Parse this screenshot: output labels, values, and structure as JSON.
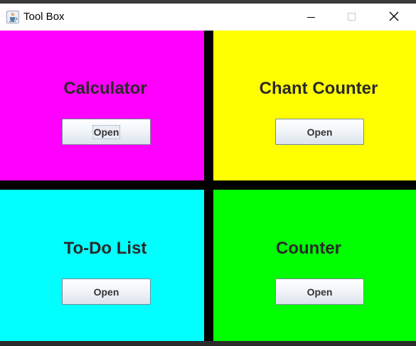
{
  "window": {
    "title": "Tool Box",
    "controls": {
      "minimize": "minimize-icon",
      "maximize": "maximize-icon",
      "close": "close-icon"
    }
  },
  "panels": [
    {
      "title": "Calculator",
      "button_label": "Open",
      "color": "#ff00ff"
    },
    {
      "title": "Chant Counter",
      "button_label": "Open",
      "color": "#ffff00"
    },
    {
      "title": "To-Do List",
      "button_label": "Open",
      "color": "#00ffff"
    },
    {
      "title": "Counter",
      "button_label": "Open",
      "color": "#00ff00"
    }
  ],
  "colors": {
    "divider": "#000000",
    "title_text": "#2a2a2a"
  }
}
